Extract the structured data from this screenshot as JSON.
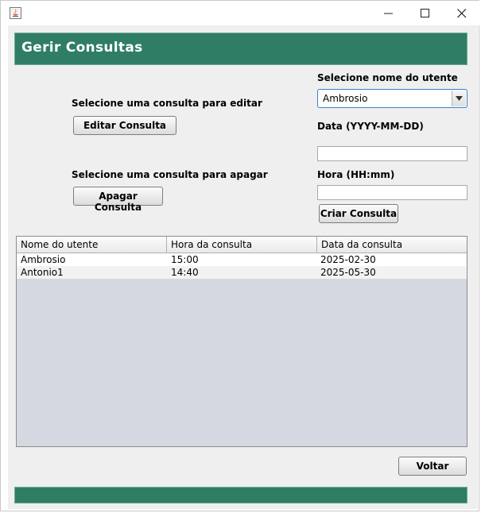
{
  "window": {
    "icon": "java-icon",
    "controls": {
      "minimize": "minimize-icon",
      "maximize": "maximize-icon",
      "close": "close-icon"
    }
  },
  "header": {
    "title": "Gerir Consultas"
  },
  "edit_section": {
    "label": "Selecione uma consulta para editar",
    "button": "Editar Consulta"
  },
  "delete_section": {
    "label": "Selecione uma consulta para apagar",
    "button": "Apagar Consulta"
  },
  "form": {
    "patient_label": "Selecione nome do utente",
    "patient_selected": "Ambrosio",
    "date_label": "Data (YYYY-MM-DD)",
    "date_value": "",
    "time_label": "Hora (HH:mm)",
    "time_value": "",
    "create_button": "Criar Consulta"
  },
  "table": {
    "columns": [
      "Nome do utente",
      "Hora da consulta",
      "Data da consulta"
    ],
    "rows": [
      [
        "Ambrosio",
        "15:00",
        "2025-02-30"
      ],
      [
        "Antonio1",
        "14:40",
        "2025-05-30"
      ]
    ]
  },
  "back_button": "Voltar",
  "colors": {
    "accent": "#2f7d65",
    "table_bg": "#d4d8e0"
  }
}
